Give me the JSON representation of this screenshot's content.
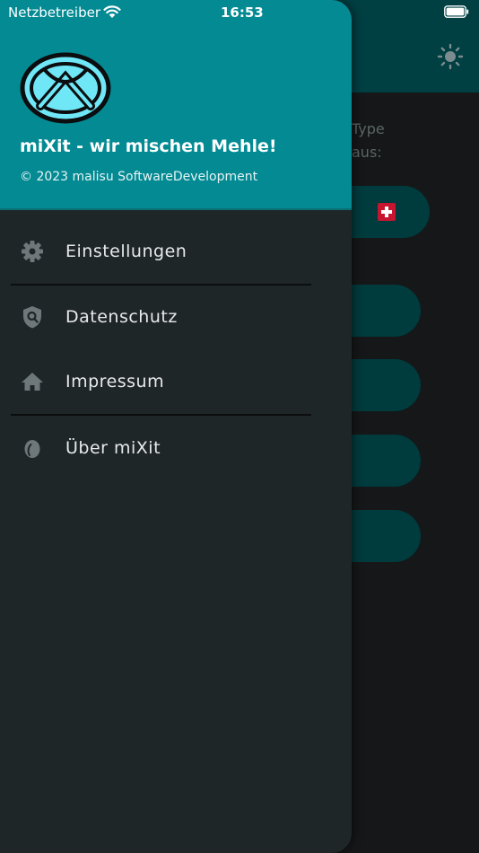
{
  "status_bar": {
    "carrier": "Netzbetreiber",
    "time": "16:53"
  },
  "background": {
    "text_line1": "Type",
    "text_line2": "aus:"
  },
  "drawer": {
    "title": "miXit - wir mischen Mehle!",
    "copyright": "© 2023 malisu SoftwareDevelopment",
    "items": [
      {
        "label": "Einstellungen",
        "icon": "gear-icon"
      },
      {
        "label": "Datenschutz",
        "icon": "privacy-shield-icon"
      },
      {
        "label": "Impressum",
        "icon": "home-icon"
      },
      {
        "label": "Über miXit",
        "icon": "grain-icon"
      }
    ]
  },
  "colors": {
    "accent": "#038a93",
    "drawer_bg": "#1f2628",
    "background": "#151718",
    "pill": "#003b3d"
  }
}
